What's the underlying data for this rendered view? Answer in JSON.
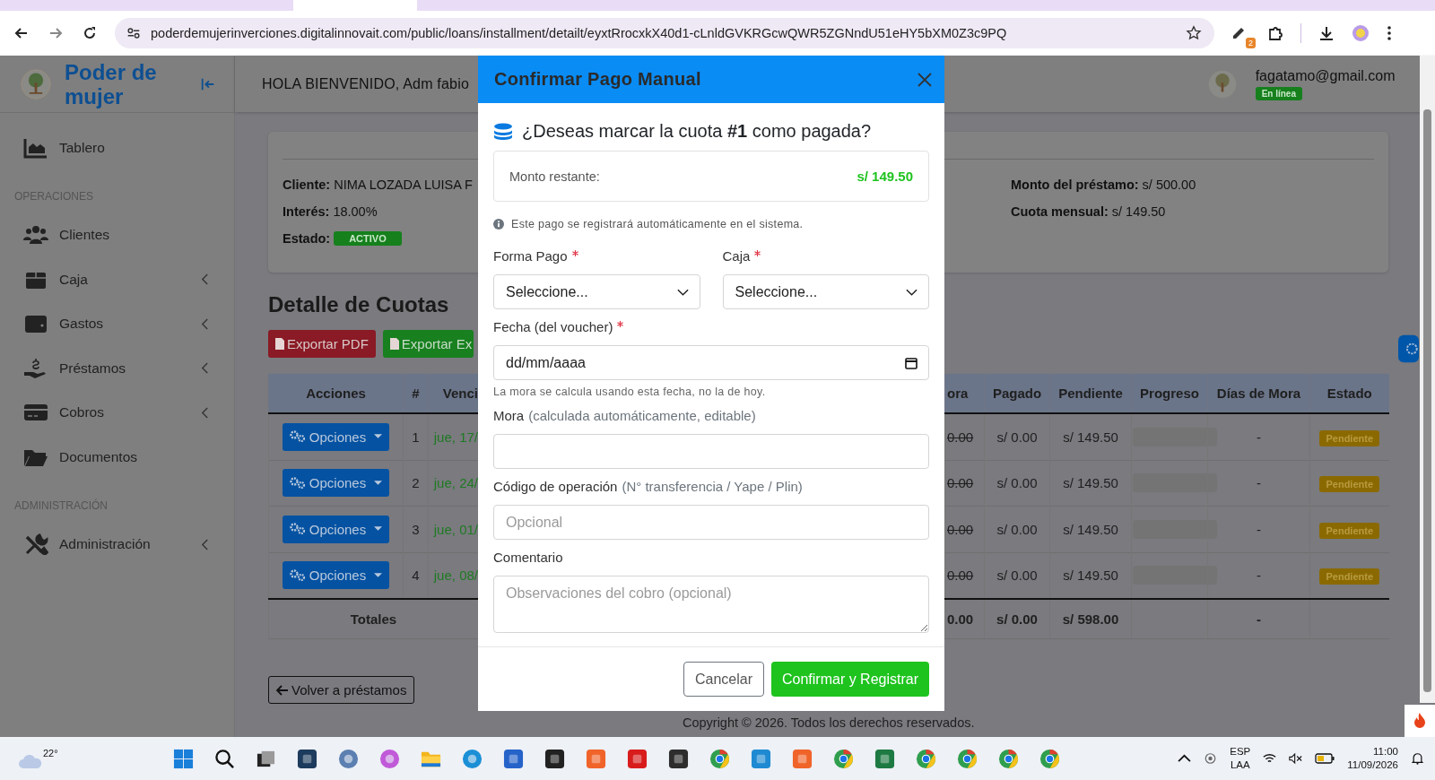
{
  "browser": {
    "url": "poderdemujerinverciones.digitalinnovait.com/public/loans/installment/detailt/eyxtRrocxkX40d1-cLnldGVKRGcwQWR5ZGNndU51eHY5bXM0Z3c9PQ",
    "extension_badge": "2"
  },
  "sidebar": {
    "brand": "Poder de mujer",
    "items": [
      {
        "kind": "link",
        "label": "Tablero",
        "submenu": false
      },
      {
        "kind": "section",
        "label": "OPERACIONES"
      },
      {
        "kind": "link",
        "label": "Clientes",
        "submenu": false
      },
      {
        "kind": "link",
        "label": "Caja",
        "submenu": true
      },
      {
        "kind": "link",
        "label": "Gastos",
        "submenu": true
      },
      {
        "kind": "link",
        "label": "Préstamos",
        "submenu": true
      },
      {
        "kind": "link",
        "label": "Cobros",
        "submenu": true
      },
      {
        "kind": "link",
        "label": "Documentos",
        "submenu": false
      },
      {
        "kind": "section",
        "label": "ADMINISTRACIÓN"
      },
      {
        "kind": "link",
        "label": "Administración",
        "submenu": true
      }
    ]
  },
  "header": {
    "greeting": "HOLA BIENVENIDO, Adm fabio",
    "email": "fagatamo@gmail.com",
    "status": "En línea"
  },
  "loan": {
    "left": [
      {
        "kind": "text",
        "label": "Cliente:",
        "value": "NIMA LOZADA LUISA F"
      },
      {
        "kind": "text",
        "label": "Interés:",
        "value": "18.00%"
      },
      {
        "kind": "badge",
        "label": "Estado:",
        "value": "ACTIVO"
      }
    ],
    "right": [
      {
        "kind": "text",
        "label": "Monto del préstamo:",
        "value": "s/ 500.00"
      },
      {
        "kind": "text",
        "label": "Cuota mensual:",
        "value": "s/ 149.50"
      }
    ]
  },
  "section_title": "Detalle de Cuotas",
  "export_buttons": [
    {
      "kind": "pdf",
      "label": "Exportar PDF"
    },
    {
      "kind": "excel",
      "label": "Exportar Ex"
    }
  ],
  "table": {
    "columns": [
      "Acciones",
      "#",
      "Venci",
      "ora",
      "Pagado",
      "Pendiente",
      "Progreso",
      "Días de Mora",
      "Estado"
    ],
    "rows": [
      {
        "action": "Opciones",
        "number": "1",
        "due": "jue, 17/",
        "mora": "0.00",
        "paid": "s/ 0.00",
        "pending": "s/ 149.50",
        "level": 0,
        "days": "-",
        "status": "Pendiente"
      },
      {
        "action": "Opciones",
        "number": "2",
        "due": "jue, 24/",
        "mora": "0.00",
        "paid": "s/ 0.00",
        "pending": "s/ 149.50",
        "level": 0,
        "days": "-",
        "status": "Pendiente"
      },
      {
        "action": "Opciones",
        "number": "3",
        "due": "jue, 01/",
        "mora": "0.00",
        "paid": "s/ 0.00",
        "pending": "s/ 149.50",
        "level": 0,
        "days": "-",
        "status": "Pendiente"
      },
      {
        "action": "Opciones",
        "number": "4",
        "due": "jue, 08/",
        "mora": "0.00",
        "paid": "s/ 0.00",
        "pending": "s/ 149.50",
        "level": 0,
        "days": "-",
        "status": "Pendiente"
      }
    ],
    "totals": {
      "label": "Totales",
      "mora": "0.00",
      "paid": "s/ 0.00",
      "pending": "s/ 598.00",
      "days": "-"
    }
  },
  "back_button": "Volver a préstamos",
  "footer": "Copyright © 2026. Todos los derechos reservados.",
  "modal": {
    "title": "Confirmar Pago Manual",
    "question": "¿Deseas marcar la cuota **#1** como pagada?",
    "amount_label": "Monto restante:",
    "amount": "s/ 149.50",
    "info": "Este pago se registrará automáticamente en el sistema.",
    "fields": [
      {
        "kind": "select",
        "label": "Forma Pago",
        "required": true,
        "value": "Seleccione..."
      },
      {
        "kind": "select",
        "label": "Caja",
        "required": true,
        "value": "Seleccione..."
      },
      {
        "kind": "date",
        "label": "Fecha (del voucher)",
        "required": true,
        "placeholder": "dd/mm/aaaa",
        "hint": "La mora se calcula usando esta fecha, no la de hoy."
      },
      {
        "kind": "text",
        "label": "Mora",
        "note": "(calculada automáticamente, editable)",
        "required": false
      },
      {
        "kind": "text",
        "label": "Código de operación",
        "note": "(N° transferencia / Yape / Plin)",
        "required": false,
        "placeholder": "Opcional"
      },
      {
        "kind": "textarea",
        "label": "Comentario",
        "required": false,
        "placeholder": "Observaciones del cobro (opcional)"
      }
    ],
    "buttons": [
      {
        "kind": "secondary",
        "label": "Cancelar"
      },
      {
        "kind": "primary",
        "label": "Confirmar y Registrar"
      }
    ]
  },
  "taskbar": {
    "weather": "22°",
    "language": "ESP",
    "layout": "LAA",
    "time": "11:00",
    "date": "11/09/2026"
  }
}
